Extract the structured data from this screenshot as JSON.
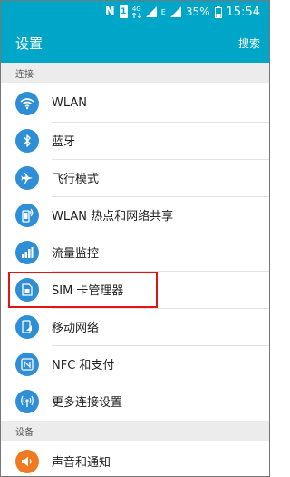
{
  "status_bar": {
    "battery": "35%",
    "time": "15:54",
    "sim_label": "1",
    "network": "4G",
    "n_label": "N",
    "data_label": "E"
  },
  "app_bar": {
    "title": "设置",
    "search": "搜索"
  },
  "sections": [
    {
      "label": "连接"
    },
    {
      "label": "设备"
    }
  ],
  "items": [
    {
      "label": "WLAN",
      "icon": "wifi-icon"
    },
    {
      "label": "蓝牙",
      "icon": "bluetooth-icon"
    },
    {
      "label": "飞行模式",
      "icon": "airplane-icon"
    },
    {
      "label": "WLAN 热点和网络共享",
      "icon": "hotspot-icon"
    },
    {
      "label": "流量监控",
      "icon": "data-usage-icon"
    },
    {
      "label": "SIM 卡管理器",
      "icon": "sim-card-icon"
    },
    {
      "label": "移动网络",
      "icon": "mobile-network-icon"
    },
    {
      "label": "NFC 和支付",
      "icon": "nfc-icon"
    },
    {
      "label": "更多连接设置",
      "icon": "more-connections-icon"
    },
    {
      "label": "声音和通知",
      "icon": "sound-icon"
    }
  ],
  "colors": {
    "accent": "#00a6c7",
    "icon_blue": "#2f8fd6",
    "icon_orange": "#ef7a22",
    "highlight": "#e01616"
  }
}
